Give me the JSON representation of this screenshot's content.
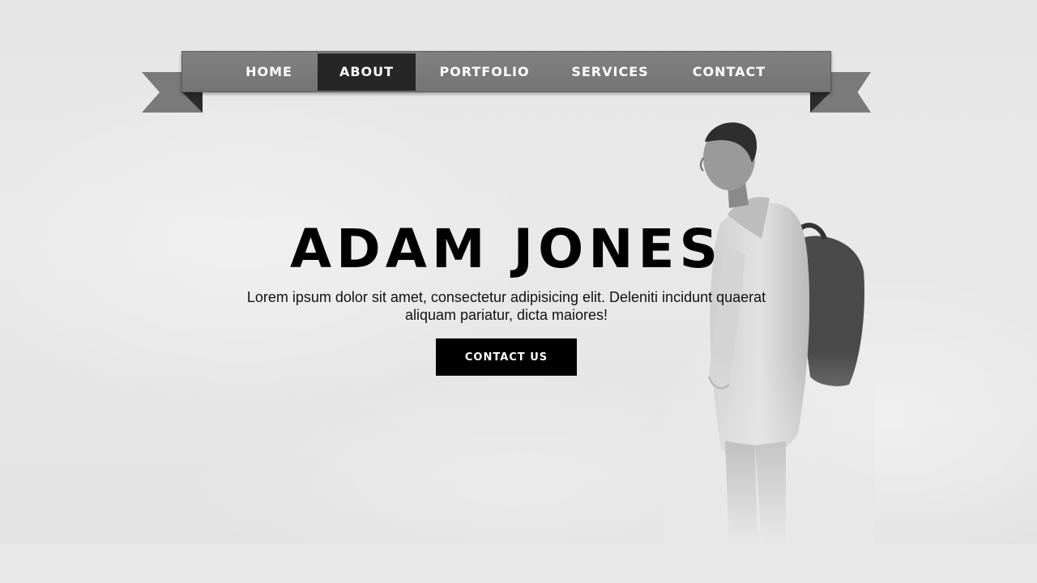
{
  "nav": {
    "items": [
      {
        "label": "Home",
        "active": false
      },
      {
        "label": "About",
        "active": true
      },
      {
        "label": "Portfolio",
        "active": false
      },
      {
        "label": "Services",
        "active": false
      },
      {
        "label": "Contact",
        "active": false
      }
    ],
    "ribbon_color": "#7a7a7a",
    "active_color": "#262626"
  },
  "hero": {
    "title": "ADAM JONES",
    "text": "Lorem ipsum dolor sit amet, consectetur adipisicing elit. Deleniti incidunt quaerat aliquam pariatur, dicta maiores!",
    "button_label": "CONTACT US",
    "image": "man-with-backpack-in-fog"
  },
  "colors": {
    "background": "#e9e9e9",
    "text": "#000000",
    "button_bg": "#000000",
    "button_text": "#ffffff"
  }
}
